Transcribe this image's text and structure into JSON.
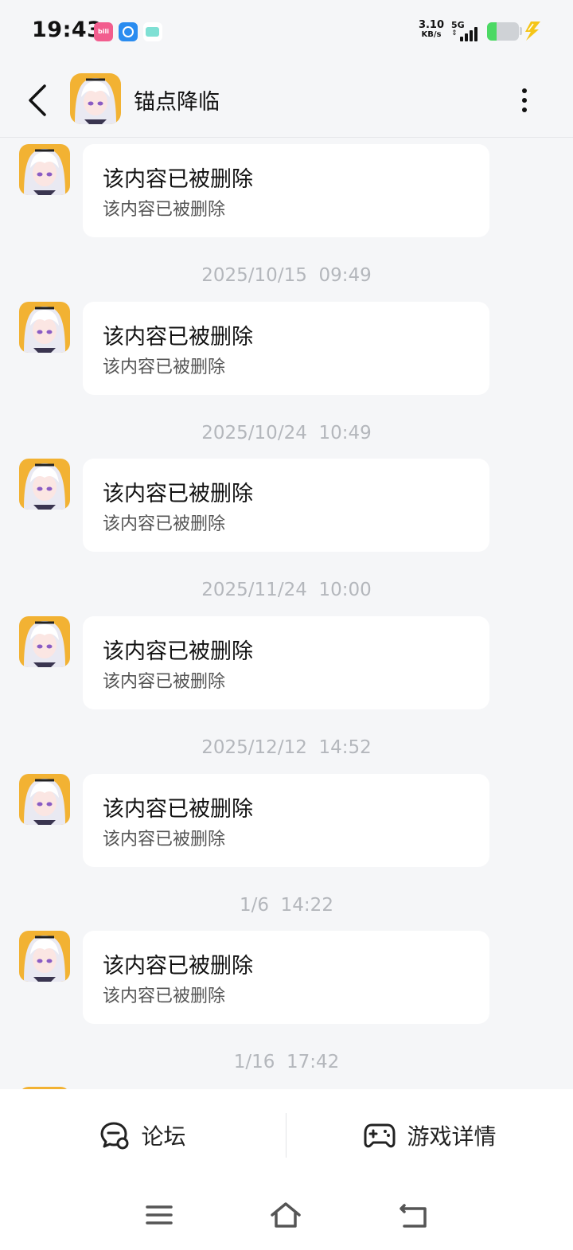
{
  "status_bar": {
    "time": "19:43",
    "app_icons": [
      "bilibili-icon",
      "browser-icon",
      "message-icon"
    ],
    "net_speed_value": "3.10",
    "net_speed_unit": "KB/s",
    "network_type": "5G",
    "battery_level": 0.3,
    "charging": true
  },
  "header": {
    "title": "锚点降临",
    "back_icon": "chevron-left-icon",
    "more_icon": "more-vertical-icon"
  },
  "messages": [
    {
      "timestamp": null,
      "title": "该内容已被删除",
      "subtitle": "该内容已被删除"
    },
    {
      "timestamp": "2025/10/15  09:49",
      "title": "该内容已被删除",
      "subtitle": "该内容已被删除"
    },
    {
      "timestamp": "2025/10/24  10:49",
      "title": "该内容已被删除",
      "subtitle": "该内容已被删除"
    },
    {
      "timestamp": "2025/11/24  10:00",
      "title": "该内容已被删除",
      "subtitle": "该内容已被删除"
    },
    {
      "timestamp": "2025/12/12  14:52",
      "title": "该内容已被删除",
      "subtitle": "该内容已被删除"
    },
    {
      "timestamp": "1/6  14:22",
      "title": "该内容已被删除",
      "subtitle": "该内容已被删除"
    }
  ],
  "trailing_timestamp": "1/16  17:42",
  "bottom_tabs": [
    {
      "label": "论坛",
      "icon": "forum-chat-icon"
    },
    {
      "label": "游戏详情",
      "icon": "gamepad-icon"
    }
  ],
  "nav_bar": [
    "menu-icon",
    "home-icon",
    "back-icon"
  ],
  "colors": {
    "background": "#f5f6f8",
    "bubble": "#ffffff",
    "timestamp": "#b4b7bc",
    "battery_fill": "#4cd964",
    "charging_bolt": "#f5c518"
  }
}
